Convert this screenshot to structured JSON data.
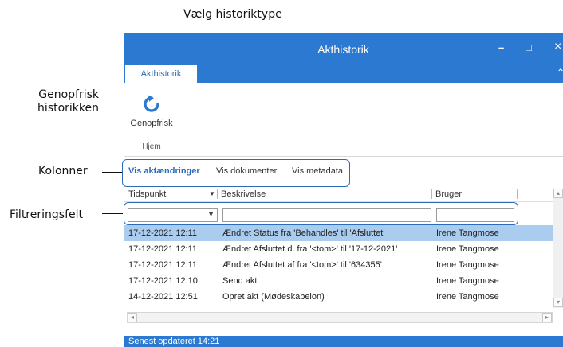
{
  "annotations": {
    "history_type": "Vælg historiktype",
    "refresh_line1": "Genopfrisk",
    "refresh_line2": "historikken",
    "columns": "Kolonner",
    "filter": "Filtreringsfelt"
  },
  "window": {
    "title": "Akthistorik",
    "minimize_glyph": "–",
    "maximize_glyph": "□",
    "close_glyph": "×",
    "ribbon_caret": "⌃"
  },
  "ribbon": {
    "tab_label": "Akthistorik",
    "refresh_label": "Genopfrisk",
    "group_label": "Hjem",
    "refresh_icon": "refresh-icon",
    "accent": "#2b79d1"
  },
  "view_tabs": [
    "Vis aktændringer",
    "Vis dokumenter",
    "Vis metadata"
  ],
  "table": {
    "headers": [
      "Tidspunkt",
      "Beskrivelse",
      "Bruger"
    ],
    "sort_glyph": "▼",
    "filter_dropdown_glyph": "▼",
    "rows": [
      {
        "time": "17-12-2021 12:11",
        "desc": "Ændret Status fra 'Behandles' til 'Afsluttet'",
        "user": "Irene Tangmose",
        "selected": true
      },
      {
        "time": "17-12-2021 12:11",
        "desc": "Ændret Afsluttet d. fra '<tom>' til '17-12-2021'",
        "user": "Irene Tangmose",
        "selected": false
      },
      {
        "time": "17-12-2021 12:11",
        "desc": "Ændret Afsluttet af fra '<tom>' til '634355'",
        "user": "Irene Tangmose",
        "selected": false
      },
      {
        "time": "17-12-2021 12:10",
        "desc": "Send akt",
        "user": "Irene Tangmose",
        "selected": false
      },
      {
        "time": "14-12-2021 12:51",
        "desc": "Opret akt (Mødeskabelon)",
        "user": "Irene Tangmose",
        "selected": false
      }
    ]
  },
  "scrollbar": {
    "left_glyph": "◂",
    "right_glyph": "▸",
    "up_glyph": "▴",
    "down_glyph": "▾"
  },
  "status": {
    "text": "Senest opdateret 14:21"
  }
}
